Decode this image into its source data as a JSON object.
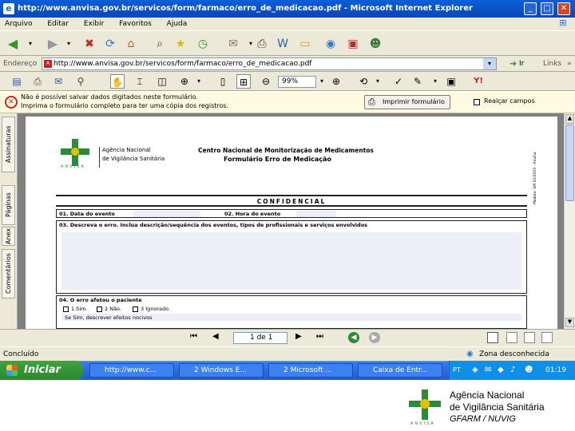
{
  "window": {
    "title": "http://www.anvisa.gov.br/servicos/form/farmaco/erro_de_medicacao.pdf - Microsoft Internet Explorer",
    "min": "_",
    "max": "□",
    "close": "✕"
  },
  "menu": [
    "Arquivo",
    "Editar",
    "Exibir",
    "Favoritos",
    "Ajuda"
  ],
  "address": {
    "label": "Endereço",
    "url": "http://www.anvisa.gov.br/servicos/form/farmaco/erro_de_medicacao.pdf",
    "go": "Ir",
    "links": "Links",
    "chevron": "»"
  },
  "pdf_toolbar": {
    "zoom": "99%"
  },
  "infobar": {
    "line1": "Não é possível salvar dados digitados neste formulário.",
    "line2": "Imprima o formulário completo para ter uma cópia dos registros.",
    "print_button": "Imprimir formulário",
    "highlight_label": "Realçar campos"
  },
  "side_tabs": [
    "Assinaturas",
    "Páginas",
    "Anex",
    "Comentários"
  ],
  "form": {
    "agency1": "Agência Nacional",
    "agency2": "de Vigilância Sanitária",
    "anvisa": "ANVISA",
    "center": "Centro Nacional de Monitorização de Medicamentos",
    "title": "Formulário Erro de Medicação",
    "side_code": "Modelo: SM 10/2005 - Anvisa",
    "confidential": "CONFIDENCIAL",
    "q01": "01. Data do evento",
    "q02": "02. Hora do evento",
    "q03": "03. Descreva o erro. Inclua descrição/sequência dos eventos, tipos de profissionais e serviços envolvidos",
    "q04": "04. O erro afetou o paciente",
    "opt1": "1.Sim.",
    "opt2": "2 Não.",
    "opt3": "3 Ignorado.",
    "q04_sub": "Se Sim, descrever efeitos nocivos"
  },
  "nav": {
    "page": "1 de 1"
  },
  "status": {
    "left": "Concluído",
    "zone": "Zona desconhecida"
  },
  "taskbar": {
    "start": "Iniciar",
    "tasks": [
      "http://www.c...",
      "2 Windows E...",
      "2 Microsoft ...",
      "Caixa de Entr..."
    ],
    "lang": "PT",
    "clock": "01:19"
  },
  "footer": {
    "line1": "Agência Nacional",
    "line2": "de Vigilância Sanitária",
    "line3": "GFARM / NUVIG",
    "anvisa": "ANVISA"
  },
  "colors": {
    "titlebar": "#0b50c8",
    "anvisa_green": "#2d8a3a",
    "anvisa_yellow": "#e3c200"
  }
}
